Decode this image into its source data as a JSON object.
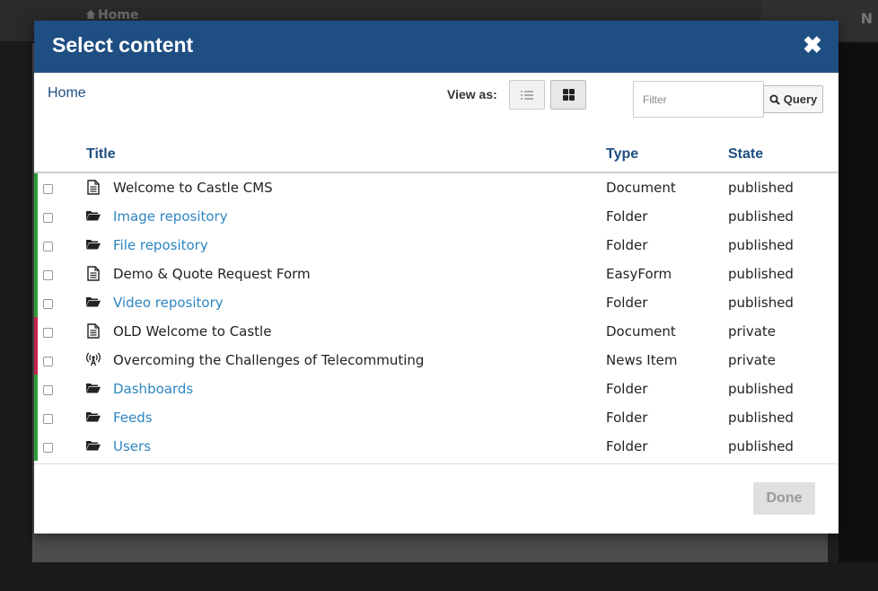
{
  "background": {
    "home_label": "Home",
    "user_initial": "N"
  },
  "modal": {
    "title": "Select content",
    "close_glyph": "✖",
    "breadcrumb": "Home",
    "view_as_label": "View as:",
    "filter_placeholder": "Filter",
    "filter_value": "",
    "query_label": "Query",
    "columns": {
      "title": "Title",
      "type": "Type",
      "state": "State"
    },
    "items": [
      {
        "title": "Welcome to Castle CMS",
        "type": "Document",
        "state": "published",
        "icon": "document-icon",
        "is_link": false,
        "status_color": "#2e9d3a"
      },
      {
        "title": "Image repository",
        "type": "Folder",
        "state": "published",
        "icon": "folder-icon",
        "is_link": true,
        "status_color": "#2e9d3a"
      },
      {
        "title": "File repository",
        "type": "Folder",
        "state": "published",
        "icon": "folder-icon",
        "is_link": true,
        "status_color": "#2e9d3a"
      },
      {
        "title": "Demo & Quote Request Form",
        "type": "EasyForm",
        "state": "published",
        "icon": "document-icon",
        "is_link": false,
        "status_color": "#2e9d3a"
      },
      {
        "title": "Video repository",
        "type": "Folder",
        "state": "published",
        "icon": "folder-icon",
        "is_link": true,
        "status_color": "#2e9d3a"
      },
      {
        "title": "OLD Welcome to Castle",
        "type": "Document",
        "state": "private",
        "icon": "document-icon",
        "is_link": false,
        "status_color": "#c0244a"
      },
      {
        "title": "Overcoming the Challenges of Telecommuting",
        "type": "News Item",
        "state": "private",
        "icon": "broadcast-icon",
        "is_link": false,
        "status_color": "#c0244a"
      },
      {
        "title": "Dashboards",
        "type": "Folder",
        "state": "published",
        "icon": "folder-icon",
        "is_link": true,
        "status_color": "#2e9d3a"
      },
      {
        "title": "Feeds",
        "type": "Folder",
        "state": "published",
        "icon": "folder-icon",
        "is_link": true,
        "status_color": "#2e9d3a"
      },
      {
        "title": "Users",
        "type": "Folder",
        "state": "published",
        "icon": "folder-icon",
        "is_link": true,
        "status_color": "#2e9d3a"
      }
    ],
    "done_label": "Done"
  },
  "colors": {
    "header_bg": "#1f4e82",
    "link": "#2e86c1",
    "published": "#2e9d3a",
    "private": "#c0244a"
  }
}
